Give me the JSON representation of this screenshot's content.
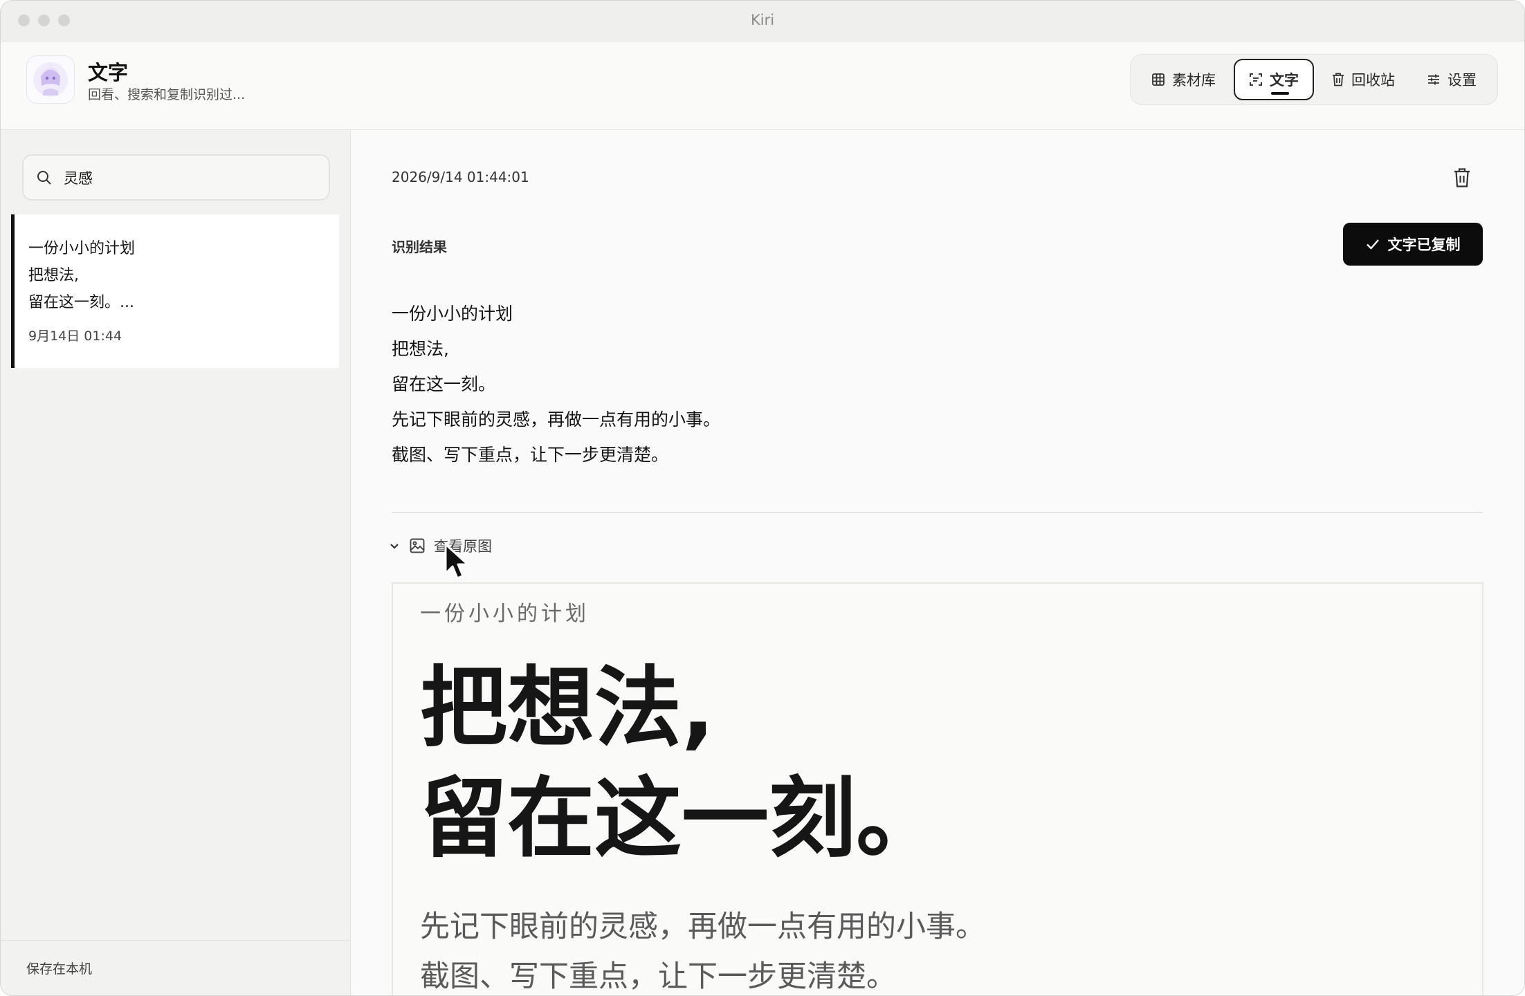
{
  "window": {
    "title": "Kiri"
  },
  "header": {
    "app_title": "文字",
    "app_subtitle": "回看、搜索和复制识别过..."
  },
  "nav": {
    "items": [
      {
        "label": "素材库",
        "icon": "grid-icon",
        "active": false
      },
      {
        "label": "文字",
        "icon": "text-scan-icon",
        "active": true
      },
      {
        "label": "回收站",
        "icon": "trash-icon",
        "active": false
      },
      {
        "label": "设置",
        "icon": "sliders-icon",
        "active": false
      }
    ]
  },
  "sidebar": {
    "search": {
      "value": "灵感"
    },
    "items": [
      {
        "lines": [
          "一份小小的计划",
          "把想法,",
          "留在这一刻。..."
        ],
        "date": "9月14日 01:44",
        "selected": true
      }
    ],
    "footer": "保存在本机"
  },
  "detail": {
    "timestamp": "2026/9/14 01:44:01",
    "result_label": "识别结果",
    "copied_button": "文字已复制",
    "ocr_lines": [
      "一份小小的计划",
      "把想法,",
      "留在这一刻。",
      "先记下眼前的灵感，再做一点有用的小事。",
      "截图、写下重点，让下一步更清楚。"
    ],
    "view_original_label": "查看原图",
    "preview": {
      "small": "一份小小的计划",
      "big": [
        "把想法,",
        "留在这一刻。"
      ],
      "body": [
        "先记下眼前的灵感，再做一点有用的小事。",
        "截图、写下重点，让下一步更清楚。"
      ]
    }
  },
  "colors": {
    "accent": "#0c0c0c",
    "background": "#f9f9f8",
    "sidebar": "#f2f2f0"
  }
}
